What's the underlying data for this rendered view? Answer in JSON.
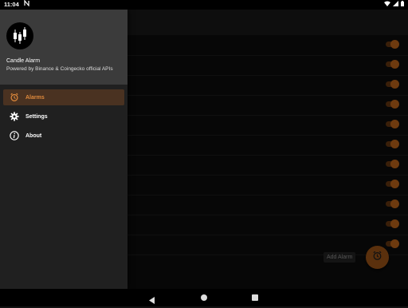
{
  "status": {
    "time": "11:04",
    "notification_icon": "n-icon"
  },
  "colors": {
    "accent": "#e08a3c",
    "fab": "#a55818",
    "drawer": "#202020",
    "header": "#3b3b3b"
  },
  "drawer": {
    "app_name": "Candle Alarm",
    "subtitle": "Powered by Binance & Coingecko official APIs",
    "items": [
      {
        "label": "Alarms",
        "icon": "alarm-clock-icon",
        "active": true
      },
      {
        "label": "Settings",
        "icon": "gear-icon",
        "active": false
      },
      {
        "label": "About",
        "icon": "info-icon",
        "active": false
      }
    ]
  },
  "alarms": {
    "toggle_count": 11,
    "all_enabled": true
  },
  "fab": {
    "label": "Add Alarm",
    "icon": "alarm-clock-icon"
  }
}
